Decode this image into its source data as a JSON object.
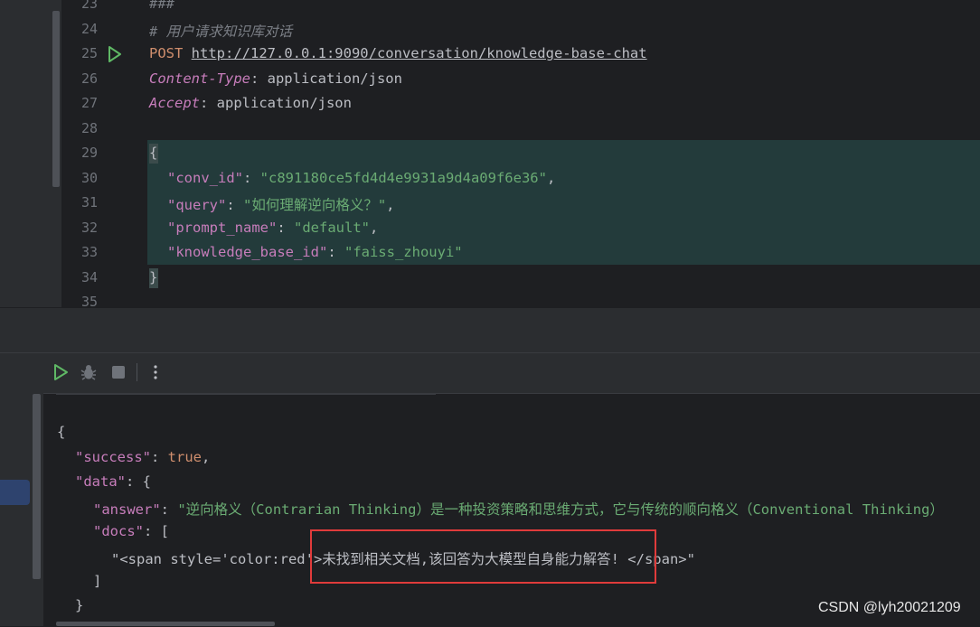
{
  "editor": {
    "line_numbers": [
      "23",
      "24",
      "25",
      "26",
      "27",
      "28",
      "29",
      "30",
      "31",
      "32",
      "33",
      "34",
      "35"
    ],
    "line23": "###",
    "comment": "# 用户请求知识库对话",
    "method": "POST",
    "url": "http://127.0.0.1:9090/conversation/knowledge-base-chat",
    "header1_name": "Content-Type",
    "header1_value": ": application/json",
    "header2_name": "Accept",
    "header2_value": ": application/json",
    "open_brace": "{",
    "close_brace": "}",
    "body": [
      {
        "key": "\"conv_id\"",
        "value": "\"c891180ce5fd4d4e9931a9d4a09f6e36\"",
        "sep": ": ",
        "end": ","
      },
      {
        "key": "\"query\"",
        "value": "\"如何理解逆向格义？\"",
        "sep": ": ",
        "end": ","
      },
      {
        "key": "\"prompt_name\"",
        "value": "\"default\"",
        "sep": ": ",
        "end": ","
      },
      {
        "key": "\"knowledge_base_id\"",
        "value": "\"faiss_zhouyi\"",
        "sep": ": ",
        "end": ""
      }
    ],
    "run_icon": "play-icon"
  },
  "toolbar": {
    "icons": [
      "run-icon",
      "debug-icon",
      "stop-icon",
      "more-vertical-icon"
    ]
  },
  "output": {
    "open_brace": "{",
    "success_key": "\"success\"",
    "success_value": "true",
    "data_key": "\"data\"",
    "answer_key": "\"answer\"",
    "answer_value": "\"逆向格义（Contrarian Thinking）是一种投资策略和思维方式，它与传统的顺向格义（Conventional Thinking）",
    "docs_key": "\"docs\"",
    "docs_item": "\"<span style='color:red'>未找到相关文档,该回答为大模型自身能力解答! </span>\"",
    "close_bracket": "]",
    "close_brace_inner": "}",
    "colon": ": ",
    "comma": ",",
    "open_curly": "{",
    "open_square": "["
  },
  "watermark": "CSDN @lyh20021209",
  "colors": {
    "highlight": "#233b3b",
    "redbox": "#e03b3b",
    "string": "#6aab73",
    "key": "#c77dbb",
    "keyword": "#cf8e6d"
  }
}
